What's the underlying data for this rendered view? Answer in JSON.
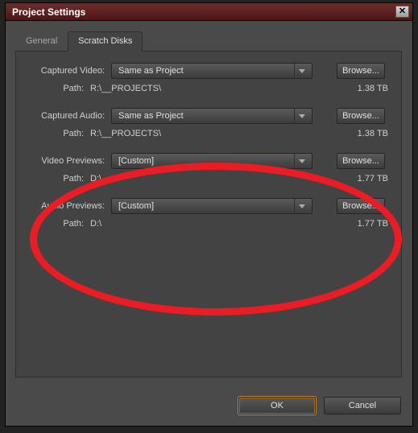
{
  "dialog": {
    "title": "Project Settings"
  },
  "tabs": {
    "general": "General",
    "scratch": "Scratch Disks"
  },
  "rows": {
    "captured_video": {
      "label": "Captured Video:",
      "value": "Same as Project",
      "browse": "Browse...",
      "path_label": "Path:",
      "path": "R:\\__PROJECTS\\",
      "size": "1.38 TB"
    },
    "captured_audio": {
      "label": "Captured Audio:",
      "value": "Same as Project",
      "browse": "Browse...",
      "path_label": "Path:",
      "path": "R:\\__PROJECTS\\",
      "size": "1.38 TB"
    },
    "video_previews": {
      "label": "Video Previews:",
      "value": "[Custom]",
      "browse": "Browse...",
      "path_label": "Path:",
      "path": "D:\\",
      "size": "1.77 TB"
    },
    "audio_previews": {
      "label": "Audio Previews:",
      "value": "[Custom]",
      "browse": "Browse...",
      "path_label": "Path:",
      "path": "D:\\",
      "size": "1.77 TB"
    }
  },
  "footer": {
    "ok": "OK",
    "cancel": "Cancel"
  },
  "annotation": {
    "color": "#ec1c24"
  }
}
